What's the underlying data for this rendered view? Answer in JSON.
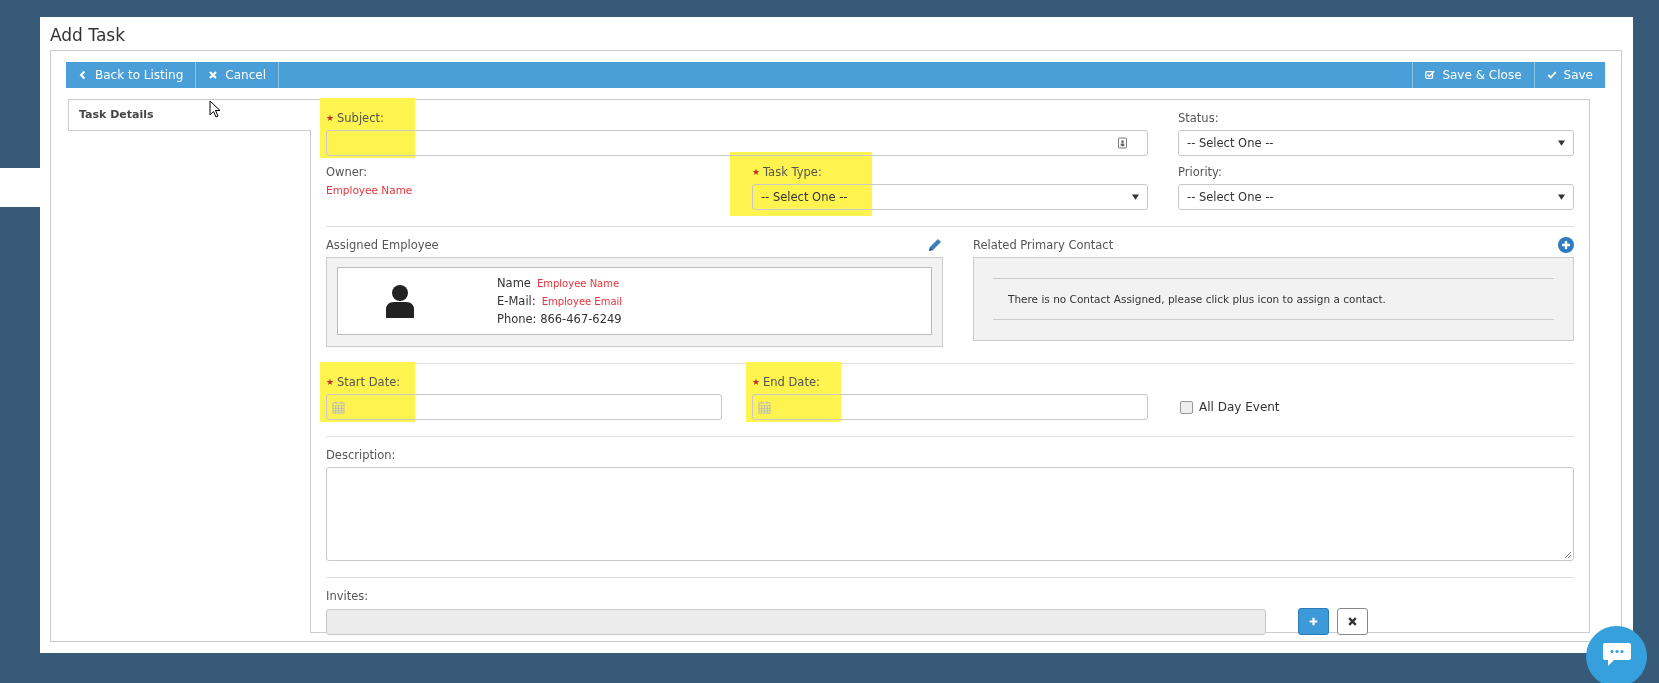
{
  "page_title": "Add Task",
  "toolbar": {
    "left_buttons": [
      "Back to Listing",
      "Cancel"
    ],
    "right_buttons": [
      "Save & Close",
      "Save"
    ]
  },
  "tabs": [
    {
      "label": "Task Details",
      "selected": true
    }
  ],
  "form": {
    "subject": {
      "label": "Subject:",
      "required": true,
      "highlighted": true
    },
    "status": {
      "label": "Status:",
      "value": "-- Select One --"
    },
    "owner": {
      "label": "Owner:",
      "value": "Employee Name"
    },
    "task_type": {
      "label": "Task Type:",
      "value": "-- Select One --",
      "required": true,
      "highlighted": true
    },
    "priority": {
      "label": "Priority:",
      "value": "-- Select One --"
    },
    "assigned_employee": {
      "title": "Assigned Employee",
      "name_label": "Name",
      "name": "Employee Name",
      "email_label": "E-Mail:",
      "email": "Employee Email",
      "phone": "Phone: 866-467-6249"
    },
    "related_contact": {
      "title": "Related Primary Contact",
      "message": "There is no Contact Assigned, please click plus icon to assign a contact."
    },
    "start_date": {
      "label": "Start Date:",
      "required": true,
      "highlighted": true
    },
    "end_date": {
      "label": "End Date:",
      "required": true,
      "highlighted": true
    },
    "all_day": {
      "label": "All Day Event",
      "checked": false
    },
    "description": {
      "label": "Description:"
    },
    "invites": {
      "label": "Invites:"
    }
  }
}
